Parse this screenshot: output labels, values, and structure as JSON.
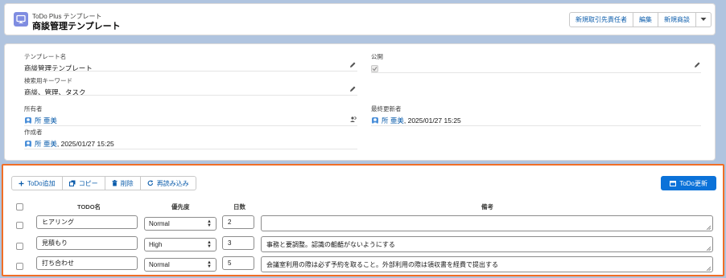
{
  "header": {
    "subtitle": "ToDo Plus テンプレート",
    "title": "商談管理テンプレート",
    "buttons": [
      "新規取引先責任者",
      "編集",
      "新規商談"
    ]
  },
  "detail": {
    "template_name_label": "テンプレート名",
    "template_name_value": "商談管理テンプレート",
    "public_label": "公開",
    "keyword_label": "検索用キーワード",
    "keyword_value": "商談、管理、タスク",
    "owner_label": "所有者",
    "owner_name": "所 亜美",
    "last_modified_label": "最終更新者",
    "last_modified_name": "所 亜美",
    "last_modified_date": ", 2025/01/27 15:25",
    "created_label": "作成者",
    "created_name": "所 亜美",
    "created_date": ", 2025/01/27 15:25"
  },
  "todo": {
    "toolbar": [
      "ToDo追加",
      "コピー",
      "削除",
      "再読み込み"
    ],
    "update_button": "ToDo更新",
    "columns": {
      "name": "TODO名",
      "priority": "優先度",
      "days": "日数",
      "note": "備考"
    },
    "rows": [
      {
        "name": "ヒアリング",
        "priority": "Normal",
        "days": "2",
        "note": ""
      },
      {
        "name": "見積もり",
        "priority": "High",
        "days": "3",
        "note": "事務と要調整。認識の齟齬がないようにする"
      },
      {
        "name": "打ち合わせ",
        "priority": "Normal",
        "days": "5",
        "note": "会議室利用の際は必ず予約を取ること。外部利用の際は領収書を経費で提出する"
      }
    ]
  }
}
